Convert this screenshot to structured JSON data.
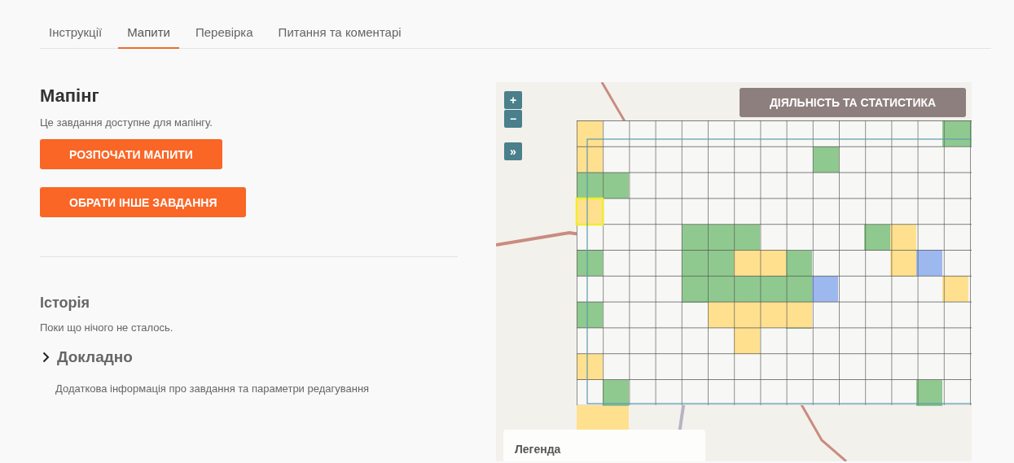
{
  "tabs": [
    {
      "label": "Інструкції",
      "selected": false
    },
    {
      "label": "Мапити",
      "selected": true
    },
    {
      "label": "Перевірка",
      "selected": false
    },
    {
      "label": "Питання та коментарі",
      "selected": false
    }
  ],
  "mapping": {
    "title": "Мапінг",
    "text": "Це завдання доступне для мапінгу.",
    "buttons": [
      "РОЗПОЧАТИ МАПИТИ",
      "ОБРАТИ ІНШЕ ЗАВДАННЯ"
    ]
  },
  "history": {
    "title": "Історія",
    "text": "Поки що нічого не сталось."
  },
  "details": {
    "title": "Докладно",
    "text": "Додаткова інформація про завдання та параметри редагування"
  },
  "map": {
    "zoom_in": "+",
    "zoom_out": "−",
    "expand": "»",
    "stats_button": "ДІЯЛЬНІСТЬ ТА СТАТИСТИКА",
    "legend_title": "Легенда"
  }
}
